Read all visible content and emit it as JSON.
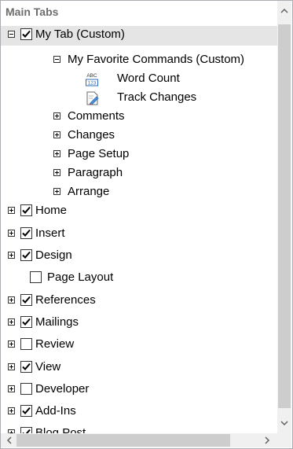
{
  "tree": {
    "header": "Main Tabs",
    "my_tab": {
      "label": "My Tab (Custom)",
      "checked": true,
      "expanded": true
    },
    "group": {
      "label": "My Favorite Commands (Custom)",
      "expanded": true
    },
    "commands": [
      {
        "label": "Word Count",
        "icon": "word-count-icon"
      },
      {
        "label": "Track Changes",
        "icon": "track-changes-icon"
      }
    ],
    "subgroups": [
      "Comments",
      "Changes",
      "Page Setup",
      "Paragraph",
      "Arrange"
    ],
    "tabs": [
      {
        "label": "Home",
        "checked": true,
        "expander": true
      },
      {
        "label": "Insert",
        "checked": true,
        "expander": true
      },
      {
        "label": "Design",
        "checked": true,
        "expander": true
      },
      {
        "label": "Page Layout",
        "checked": false,
        "expander": false
      },
      {
        "label": "References",
        "checked": true,
        "expander": true
      },
      {
        "label": "Mailings",
        "checked": true,
        "expander": true
      },
      {
        "label": "Review",
        "checked": false,
        "expander": true
      },
      {
        "label": "View",
        "checked": true,
        "expander": true
      },
      {
        "label": "Developer",
        "checked": false,
        "expander": true
      },
      {
        "label": "Add-Ins",
        "checked": true,
        "expander": true
      },
      {
        "label": "Blog Post",
        "checked": true,
        "expander": true
      }
    ]
  },
  "colors": {
    "selection": "#e5e5e5",
    "scrollbar_track": "#f0f0f0",
    "scrollbar_thumb": "#cdcdcd",
    "header_text": "#6d6d6d"
  }
}
